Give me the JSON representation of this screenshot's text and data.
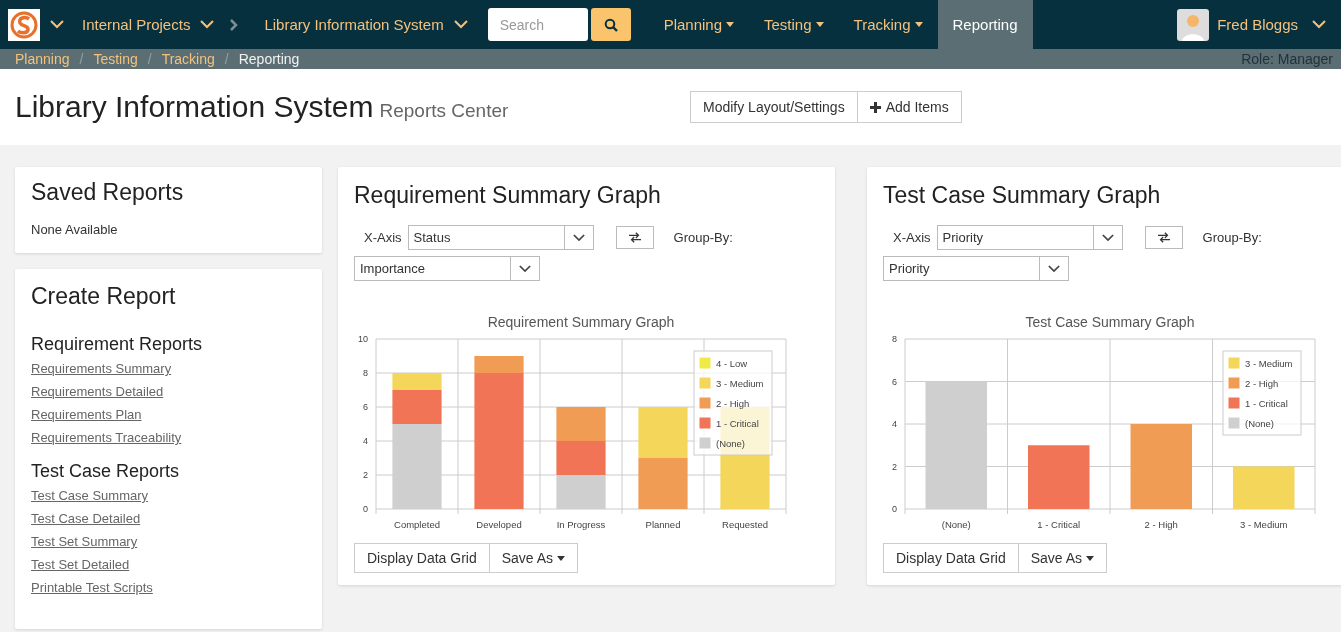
{
  "navbar": {
    "project_group": "Internal Projects",
    "project": "Library Information System",
    "search": {
      "placeholder": "Search"
    },
    "menus": [
      {
        "label": "Planning",
        "selected": false,
        "dropdown": true
      },
      {
        "label": "Testing",
        "selected": false,
        "dropdown": true
      },
      {
        "label": "Tracking",
        "selected": false,
        "dropdown": true
      },
      {
        "label": "Reporting",
        "selected": true,
        "dropdown": false
      }
    ],
    "user": {
      "name": "Fred Bloggs"
    }
  },
  "breadcrumb": {
    "items": [
      "Planning",
      "Testing",
      "Tracking",
      "Reporting"
    ],
    "separator": "/",
    "role": "Role: Manager"
  },
  "header": {
    "title": "Library Information System",
    "subtitle": "Reports Center",
    "buttons": [
      {
        "label": "Modify Layout/Settings",
        "kind": "plain"
      },
      {
        "label": "Add Items",
        "kind": "add"
      }
    ]
  },
  "saved_reports": {
    "title": "Saved Reports",
    "empty_text": "None Available"
  },
  "create_report": {
    "title": "Create Report",
    "groups": [
      {
        "heading": "Requirement Reports",
        "links": [
          "Requirements Summary",
          "Requirements Detailed",
          "Requirements Plan",
          "Requirements Traceability"
        ]
      },
      {
        "heading": "Test Case Reports",
        "links": [
          "Test Case Summary",
          "Test Case Detailed",
          "Test Set Summary",
          "Test Set Detailed",
          "Printable Test Scripts"
        ]
      }
    ]
  },
  "graphs": [
    {
      "title": "Requirement Summary Graph",
      "x_axis": {
        "label": "X-Axis",
        "value": "Status"
      },
      "group_by": {
        "label": "Group-By:",
        "value": "Importance"
      },
      "chart_data": {
        "type": "bar",
        "title": "Requirement Summary Graph",
        "stacked": true,
        "grid": true,
        "legend": "upper right",
        "categories": [
          "Completed",
          "Developed",
          "In Progress",
          "Planned",
          "Requested"
        ],
        "ylim": [
          0,
          10
        ],
        "yticks": [
          0,
          2,
          4,
          6,
          8,
          10
        ],
        "series": [
          {
            "name": "(None)",
            "color": "#cfcfcf",
            "values": [
              5,
              0,
              2,
              0,
              0
            ]
          },
          {
            "name": "1 - Critical",
            "color": "#f27457",
            "values": [
              2,
              8,
              2,
              0,
              0
            ]
          },
          {
            "name": "2 - High",
            "color": "#f19c55",
            "values": [
              0,
              1,
              2,
              3,
              0
            ]
          },
          {
            "name": "3 - Medium",
            "color": "#f4d65a",
            "values": [
              1,
              0,
              0,
              3,
              6
            ]
          },
          {
            "name": "4 - Low",
            "color": "#f0ea47",
            "values": [
              0,
              0,
              0,
              0,
              0
            ]
          }
        ]
      },
      "buttons": [
        {
          "label": "Display Data Grid",
          "dropdown": false
        },
        {
          "label": "Save As",
          "dropdown": true
        }
      ]
    },
    {
      "title": "Test Case Summary Graph",
      "x_axis": {
        "label": "X-Axis",
        "value": "Priority"
      },
      "group_by": {
        "label": "Group-By:",
        "value": "Priority"
      },
      "chart_data": {
        "type": "bar",
        "title": "Test Case Summary Graph",
        "stacked": true,
        "grid": true,
        "legend": "upper right",
        "categories": [
          "(None)",
          "1 - Critical",
          "2 - High",
          "3 - Medium"
        ],
        "ylim": [
          0,
          8
        ],
        "yticks": [
          0,
          2,
          4,
          6,
          8
        ],
        "series": [
          {
            "name": "(None)",
            "color": "#cfcfcf",
            "values": [
              6,
              null,
              null,
              null
            ]
          },
          {
            "name": "1 - Critical",
            "color": "#f27457",
            "values": [
              null,
              3,
              null,
              null
            ]
          },
          {
            "name": "2 - High",
            "color": "#f19c55",
            "values": [
              null,
              null,
              4,
              null
            ]
          },
          {
            "name": "3 - Medium",
            "color": "#f4d65a",
            "values": [
              null,
              null,
              null,
              2
            ]
          }
        ]
      },
      "buttons": [
        {
          "label": "Display Data Grid",
          "dropdown": false
        },
        {
          "label": "Save As",
          "dropdown": true
        }
      ]
    }
  ]
}
